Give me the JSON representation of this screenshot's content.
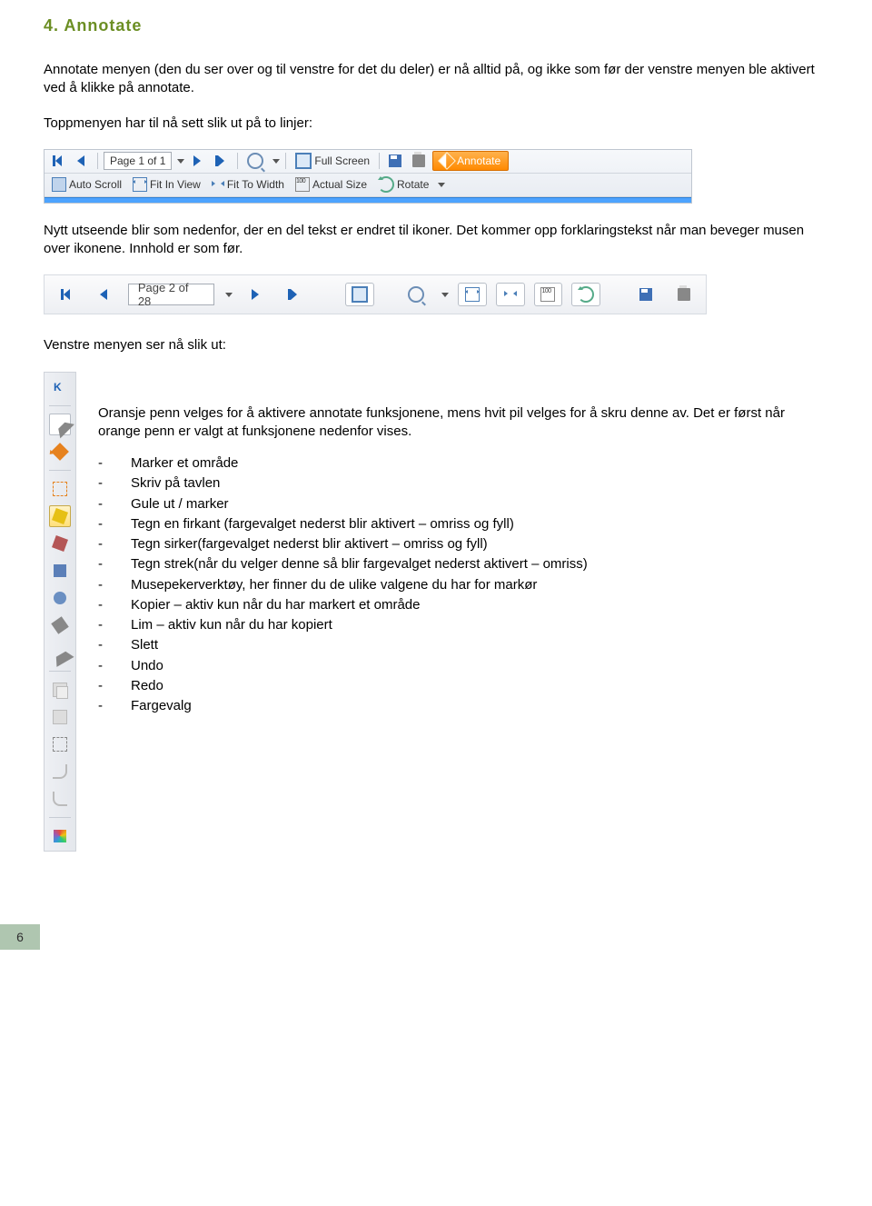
{
  "heading": "4. Annotate",
  "para1": "Annotate menyen (den du ser over og til venstre for det du deler) er nå alltid på, og ikke som før der venstre menyen ble aktivert ved å klikke på annotate.",
  "para2": "Toppmenyen har til nå sett slik ut på to linjer:",
  "toolbar1": {
    "page_label": "Page 1 of 1",
    "full_screen": "Full Screen",
    "annotate": "Annotate",
    "auto_scroll": "Auto Scroll",
    "fit_in_view": "Fit In View",
    "fit_to_width": "Fit To Width",
    "actual_size": "Actual Size",
    "actual_size_value": "100",
    "rotate": "Rotate"
  },
  "para3": "Nytt utseende blir som nedenfor, der en del tekst er endret til ikoner. Det kommer opp forklaringstekst når man beveger musen over ikonene. Innhold er som før.",
  "toolbar2": {
    "page_label": "Page 2 of 28",
    "zoom_100": "100"
  },
  "para4": "Venstre menyen ser nå slik ut:",
  "side_para": "Oransje penn velges for å aktivere annotate funksjonene, mens hvit pil velges for å skru denne av. Det er først når orange penn er valgt at funksjonene nedenfor vises.",
  "bullets": [
    "Marker et område",
    "Skriv på tavlen",
    "Gule ut / marker",
    "Tegn en firkant (fargevalget nederst blir aktivert – omriss og fyll)",
    "Tegn sirker(fargevalget nederst blir aktivert – omriss og fyll)",
    "Tegn strek(når du velger denne så blir fargevalget nederst aktivert – omriss)",
    "Musepekerverktøy, her finner du de ulike valgene du har for markør",
    "Kopier – aktiv kun når du har markert et område",
    "Lim – aktiv kun når du har kopiert",
    "Slett",
    "Undo",
    "Redo",
    "Fargevalg"
  ],
  "page_number": "6"
}
